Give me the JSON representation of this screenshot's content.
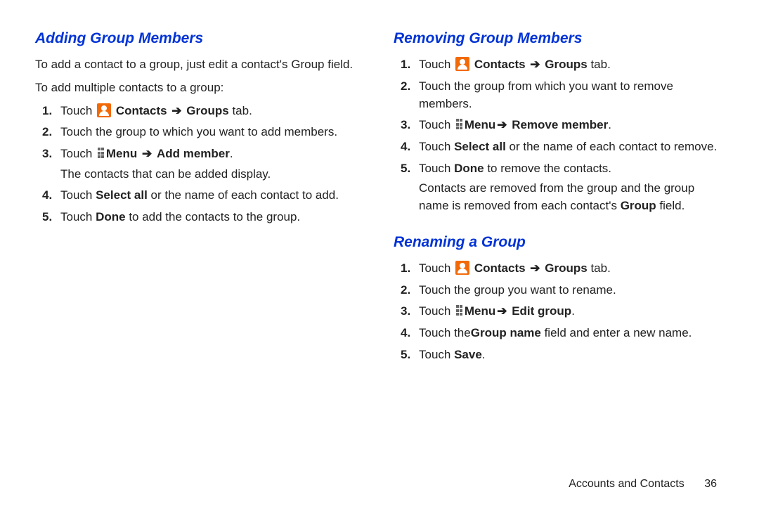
{
  "left": {
    "s1": {
      "title": "Adding Group Members",
      "intro1": "To add a contact to a group, just edit a contact's Group field.",
      "intro2": "To add multiple contacts to a group:",
      "steps": [
        {
          "n": "1.",
          "pre": "Touch ",
          "b1": "Contacts",
          "arrow1": "➔",
          "b2": "Groups",
          "post": " tab."
        },
        {
          "n": "2.",
          "text": "Touch the group to which you want to add members."
        },
        {
          "n": "3.",
          "pre": "Touch ",
          "b1": "Menu",
          "arrow1": "➔",
          "b2": "Add member",
          "post": ".",
          "sub": "The contacts that can be added display."
        },
        {
          "n": "4.",
          "pre": "Touch ",
          "b1": "Select all",
          "post": " or the name of each contact to add."
        },
        {
          "n": "5.",
          "pre": "Touch ",
          "b1": "Done",
          "post": " to add the contacts to the group."
        }
      ]
    }
  },
  "right": {
    "s1": {
      "title": "Removing Group Members",
      "steps": [
        {
          "n": "1.",
          "pre": "Touch ",
          "b1": "Contacts",
          "arrow1": "➔",
          "b2": "Groups",
          "post": " tab."
        },
        {
          "n": "2.",
          "text": "Touch the group from which you want to remove members."
        },
        {
          "n": "3.",
          "pre": "Touch ",
          "b1": "Menu",
          "arrow1": "➔",
          "b2": " Remove member",
          "post": "."
        },
        {
          "n": "4.",
          "pre": "Touch ",
          "b1": "Select all",
          "post": " or the name of each contact to remove."
        },
        {
          "n": "5.",
          "pre": "Touch ",
          "b1": "Done",
          "post": " to remove the contacts.",
          "sub": "Contacts are removed from the group and the group name is removed from each contact's ",
          "subb": "Group",
          "subpost": " field."
        }
      ]
    },
    "s2": {
      "title": "Renaming a Group",
      "steps": [
        {
          "n": "1.",
          "pre": "Touch ",
          "b1": "Contacts",
          "arrow1": "➔",
          "b2": "Groups",
          "post": " tab."
        },
        {
          "n": "2.",
          "text": "Touch the group you want to rename."
        },
        {
          "n": "3.",
          "pre": "Touch ",
          "b1": "Menu",
          "arrow1": "➔",
          "b2": " Edit group",
          "post": "."
        },
        {
          "n": "4.",
          "pre": "Touch the",
          "b1": "Group name",
          "post": "  field and enter a new name."
        },
        {
          "n": "5.",
          "pre": "Touch ",
          "b1": "Save",
          "post": "."
        }
      ]
    }
  },
  "footer": {
    "chapter": "Accounts and Contacts",
    "page": "36"
  }
}
